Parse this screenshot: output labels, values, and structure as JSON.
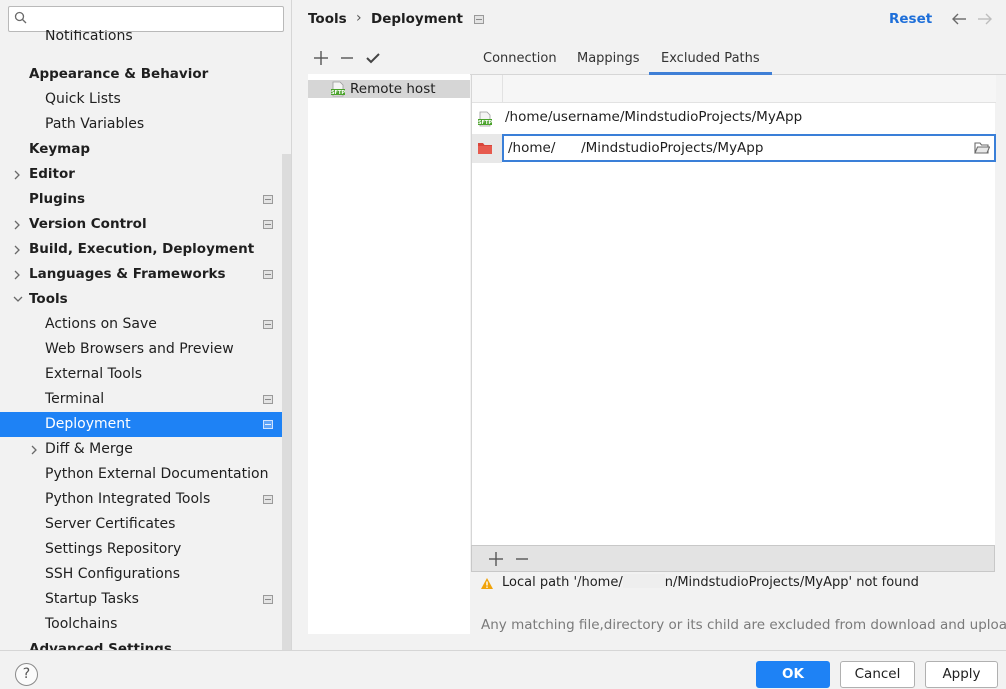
{
  "search": {
    "value": "",
    "placeholder": ""
  },
  "sidebar": {
    "items": [
      {
        "label": "Notifications",
        "bold": false,
        "indent": 1,
        "chevron": "",
        "project": false,
        "clipped": true
      },
      {
        "label": "Appearance & Behavior",
        "bold": true,
        "indent": 0,
        "chevron": "",
        "project": false
      },
      {
        "label": "Quick Lists",
        "bold": false,
        "indent": 1,
        "chevron": "",
        "project": false
      },
      {
        "label": "Path Variables",
        "bold": false,
        "indent": 1,
        "chevron": "",
        "project": false
      },
      {
        "label": "Keymap",
        "bold": true,
        "indent": 0,
        "chevron": "",
        "project": false
      },
      {
        "label": "Editor",
        "bold": true,
        "indent": 0,
        "chevron": "right",
        "project": false
      },
      {
        "label": "Plugins",
        "bold": true,
        "indent": 0,
        "chevron": "",
        "project": true
      },
      {
        "label": "Version Control",
        "bold": true,
        "indent": 0,
        "chevron": "right",
        "project": true
      },
      {
        "label": "Build, Execution, Deployment",
        "bold": true,
        "indent": 0,
        "chevron": "right",
        "project": false
      },
      {
        "label": "Languages & Frameworks",
        "bold": true,
        "indent": 0,
        "chevron": "right",
        "project": true
      },
      {
        "label": "Tools",
        "bold": true,
        "indent": 0,
        "chevron": "down",
        "project": false
      },
      {
        "label": "Actions on Save",
        "bold": false,
        "indent": 1,
        "chevron": "",
        "project": true
      },
      {
        "label": "Web Browsers and Preview",
        "bold": false,
        "indent": 1,
        "chevron": "",
        "project": false
      },
      {
        "label": "External Tools",
        "bold": false,
        "indent": 1,
        "chevron": "",
        "project": false
      },
      {
        "label": "Terminal",
        "bold": false,
        "indent": 1,
        "chevron": "",
        "project": true
      },
      {
        "label": "Deployment",
        "bold": false,
        "indent": 1,
        "chevron": "",
        "project": true,
        "selected": true
      },
      {
        "label": "Diff & Merge",
        "bold": false,
        "indent": 1,
        "chevron": "right",
        "project": false
      },
      {
        "label": "Python External Documentation",
        "bold": false,
        "indent": 1,
        "chevron": "",
        "project": false
      },
      {
        "label": "Python Integrated Tools",
        "bold": false,
        "indent": 1,
        "chevron": "",
        "project": true
      },
      {
        "label": "Server Certificates",
        "bold": false,
        "indent": 1,
        "chevron": "",
        "project": false
      },
      {
        "label": "Settings Repository",
        "bold": false,
        "indent": 1,
        "chevron": "",
        "project": false
      },
      {
        "label": "SSH Configurations",
        "bold": false,
        "indent": 1,
        "chevron": "",
        "project": false
      },
      {
        "label": "Startup Tasks",
        "bold": false,
        "indent": 1,
        "chevron": "",
        "project": true
      },
      {
        "label": "Toolchains",
        "bold": false,
        "indent": 1,
        "chevron": "",
        "project": false
      },
      {
        "label": "Advanced Settings",
        "bold": true,
        "indent": 0,
        "chevron": "",
        "project": false
      }
    ]
  },
  "header": {
    "crumb_tools": "Tools",
    "crumb_sep": "›",
    "crumb_deployment": "Deployment",
    "reset": "Reset"
  },
  "servers": {
    "items": [
      {
        "label": "Remote host",
        "icon": "sftp-icon"
      }
    ]
  },
  "tabs": {
    "connection": "Connection",
    "mappings": "Mappings",
    "excluded": "Excluded Paths"
  },
  "excluded": {
    "rows": [
      {
        "path": "/home/username/MindstudioProjects/MyApp",
        "icon": "sftp-icon"
      }
    ],
    "edit_prefix": "/home/",
    "edit_suffix": "/MindstudioProjects/MyApp",
    "warning_prefix": "Local path '/home/",
    "warning_suffix": "n/MindstudioProjects/MyApp' not found",
    "hint": "Any matching file,directory or its child are excluded from download and upload"
  },
  "footer": {
    "help": "?",
    "ok": "OK",
    "cancel": "Cancel",
    "apply": "Apply"
  },
  "colors": {
    "accent": "#1e82f5",
    "link": "#1e6fd9",
    "sftp_green": "#4aa22b",
    "folder_red": "#d9453a",
    "warning": "#f0a30a"
  }
}
